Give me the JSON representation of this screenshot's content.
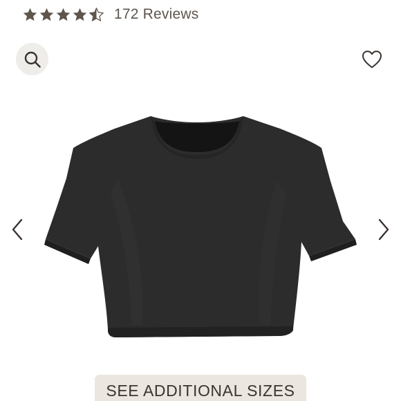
{
  "rating": {
    "value": 4.5,
    "max": 5,
    "review_count_text": "172 Reviews",
    "star_color": "#5e554c"
  },
  "icons": {
    "search": "search-icon",
    "wishlist": "heart-icon",
    "prev": "chevron-left-icon",
    "next": "chevron-right-icon"
  },
  "product": {
    "image": "black-cropped-t-shirt"
  },
  "actions": {
    "sizes_label": "SEE ADDITIONAL SIZES"
  },
  "colors": {
    "accent_text": "#5e554c",
    "search_bg": "#efedea",
    "button_bg": "#ebe6df",
    "garment": "#2b2b2b"
  }
}
